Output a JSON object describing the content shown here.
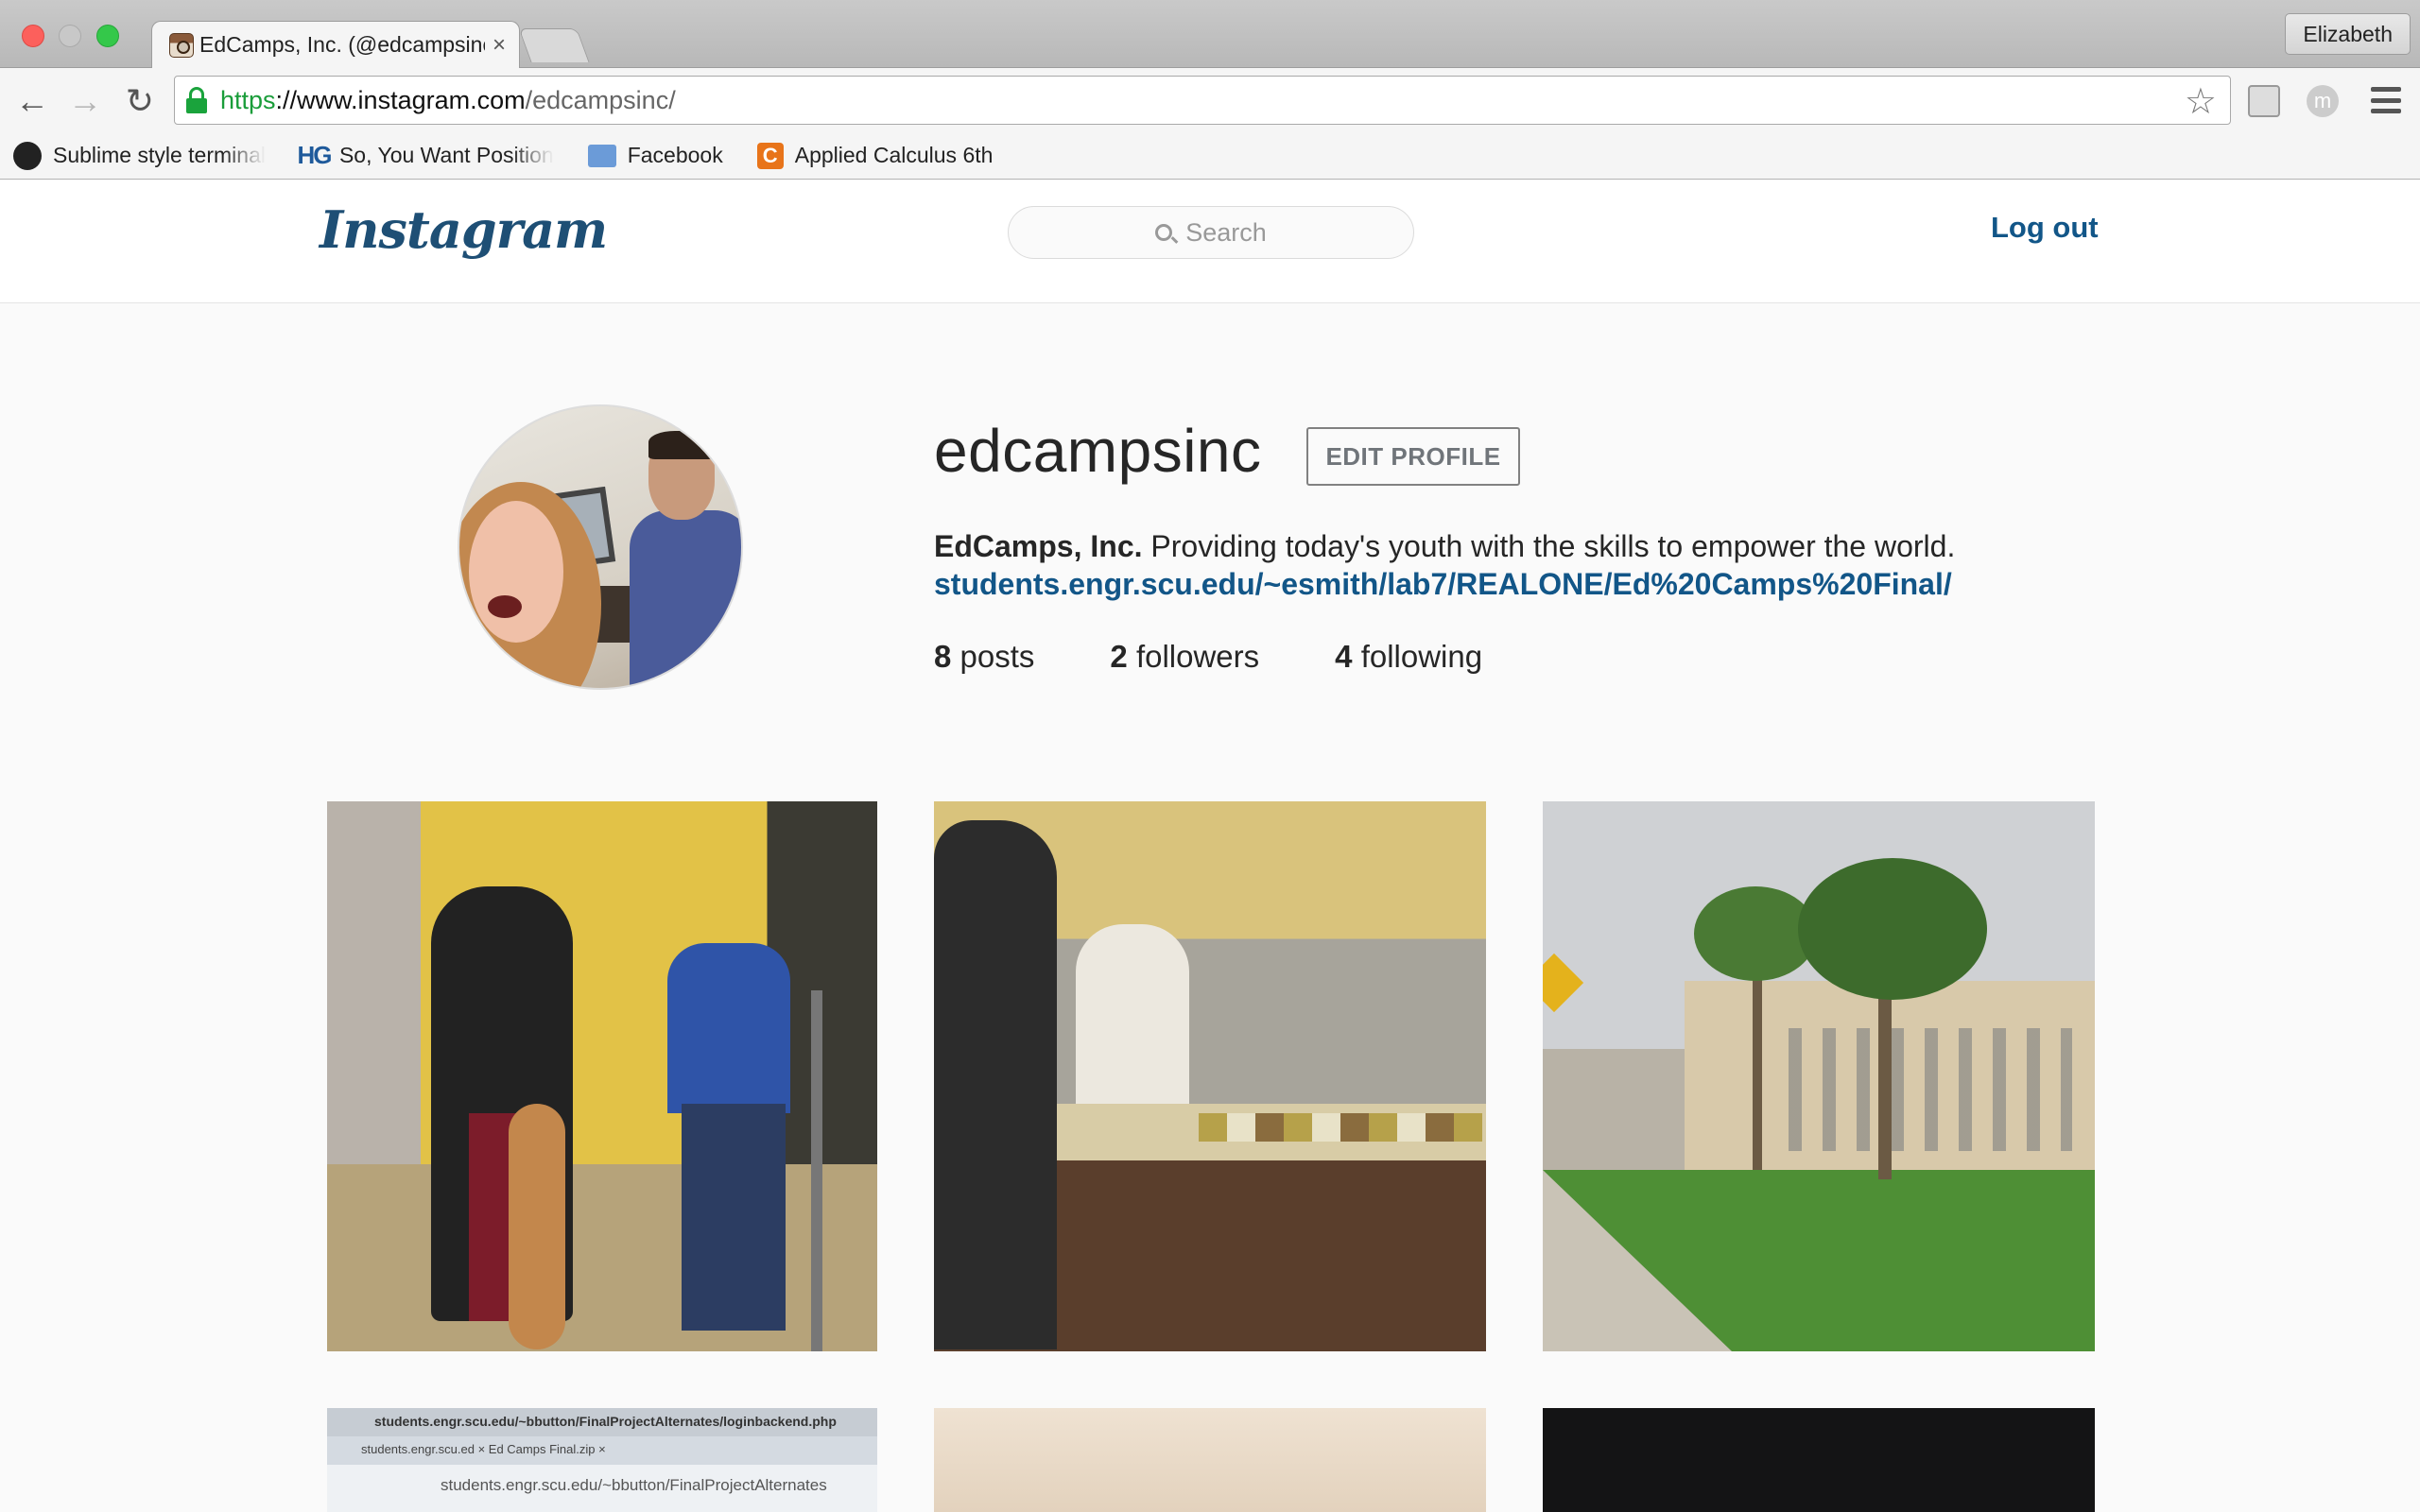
{
  "browser": {
    "tab_title": "EdCamps, Inc. (@edcampsinc)",
    "tab_close": "×",
    "profile_name": "Elizabeth",
    "url_scheme": "https",
    "url_host": "://www.instagram.com",
    "url_path": "/edcampsinc/",
    "bookmarks": [
      {
        "label": "Sublime style terminal",
        "icon": "github-icon"
      },
      {
        "label": "So, You Want Position",
        "icon": "hg-icon"
      },
      {
        "label": "Facebook",
        "icon": "folder-icon"
      },
      {
        "label": "Applied Calculus 6th",
        "icon": "c-icon"
      }
    ]
  },
  "header": {
    "logo": "Instagram",
    "search_placeholder": "Search",
    "logout": "Log out"
  },
  "profile": {
    "username": "edcampsinc",
    "edit_button": "EDIT PROFILE",
    "full_name": "EdCamps, Inc.",
    "bio": "Providing today's youth with the skills to empower the world.",
    "link": "students.engr.scu.edu/~esmith/lab7/REALONE/Ed%20Camps%20Final/",
    "stats": {
      "posts_count": "8",
      "posts_label": "posts",
      "followers_count": "2",
      "followers_label": "followers",
      "following_count": "4",
      "following_label": "following"
    }
  },
  "photo4_text": {
    "bar": "students.engr.scu.edu/~bbutton/FinalProjectAlternates/loginbackend.php",
    "tabs": "students.engr.scu.ed  ×   Ed Camps Final.zip  ×",
    "addr": "students.engr.scu.edu/~bbutton/FinalProjectAlternates"
  }
}
